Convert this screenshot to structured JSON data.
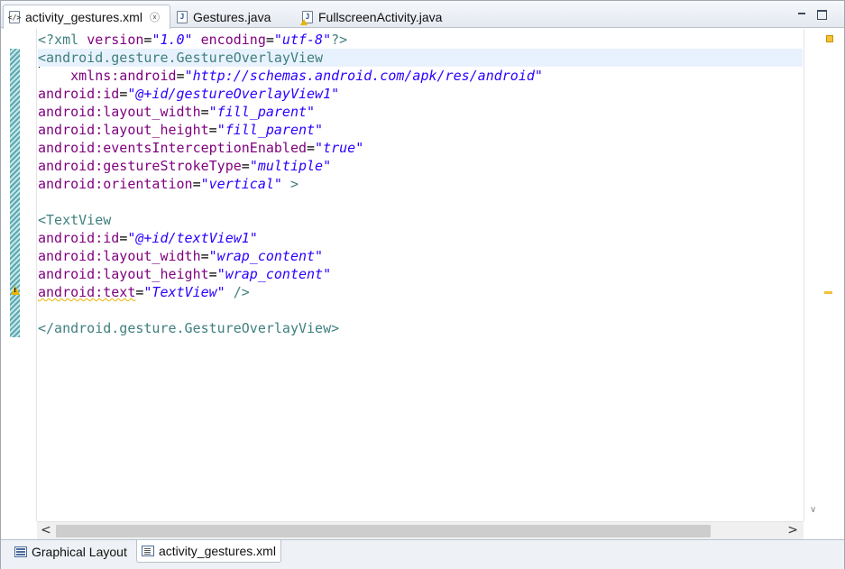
{
  "editor_tabs": [
    {
      "label": "activity_gestures.xml",
      "icon": "xml-file-icon",
      "active": true,
      "close_glyph": "ⓧ"
    },
    {
      "label": "Gestures.java",
      "icon": "java-file-icon",
      "active": false
    },
    {
      "label": "FullscreenActivity.java",
      "icon": "java-file-warning-icon",
      "active": false
    }
  ],
  "code_lines": [
    {
      "parts": [
        [
          "tag",
          "<?xml "
        ],
        [
          "attr",
          "version"
        ],
        [
          "eq",
          "="
        ],
        [
          "val",
          "\"1.0\""
        ],
        [
          "tag",
          " "
        ],
        [
          "attr",
          "encoding"
        ],
        [
          "eq",
          "="
        ],
        [
          "val",
          "\"utf-8\""
        ],
        [
          "tag",
          "?>"
        ]
      ]
    },
    {
      "parts": [
        [
          "tag",
          "<android.gesture.GestureOverlayView"
        ]
      ],
      "current": true
    },
    {
      "parts": [
        [
          "tag",
          "    "
        ],
        [
          "attr",
          "xmlns:android"
        ],
        [
          "eq",
          "="
        ],
        [
          "val",
          "\"http://schemas.android.com/apk/res/android\""
        ]
      ]
    },
    {
      "parts": [
        [
          "attr",
          "android:id"
        ],
        [
          "eq",
          "="
        ],
        [
          "val",
          "\"@+id/gestureOverlayView1\""
        ]
      ]
    },
    {
      "parts": [
        [
          "attr",
          "android:layout_width"
        ],
        [
          "eq",
          "="
        ],
        [
          "val",
          "\"fill_parent\""
        ]
      ]
    },
    {
      "parts": [
        [
          "attr",
          "android:layout_height"
        ],
        [
          "eq",
          "="
        ],
        [
          "val",
          "\"fill_parent\""
        ]
      ]
    },
    {
      "parts": [
        [
          "attr",
          "android:eventsInterceptionEnabled"
        ],
        [
          "eq",
          "="
        ],
        [
          "val",
          "\"true\""
        ]
      ]
    },
    {
      "parts": [
        [
          "attr",
          "android:gestureStrokeType"
        ],
        [
          "eq",
          "="
        ],
        [
          "val",
          "\"multiple\""
        ]
      ]
    },
    {
      "parts": [
        [
          "attr",
          "android:orientation"
        ],
        [
          "eq",
          "="
        ],
        [
          "val",
          "\"vertical\""
        ],
        [
          "tag",
          " >"
        ]
      ]
    },
    {
      "parts": []
    },
    {
      "parts": [
        [
          "tag",
          "<TextView"
        ]
      ]
    },
    {
      "parts": [
        [
          "attr",
          "android:id"
        ],
        [
          "eq",
          "="
        ],
        [
          "val",
          "\"@+id/textView1\""
        ]
      ]
    },
    {
      "parts": [
        [
          "attr",
          "android:layout_width"
        ],
        [
          "eq",
          "="
        ],
        [
          "val",
          "\"wrap_content\""
        ]
      ]
    },
    {
      "parts": [
        [
          "attr",
          "android:layout_height"
        ],
        [
          "eq",
          "="
        ],
        [
          "val",
          "\"wrap_content\""
        ]
      ]
    },
    {
      "parts": [
        [
          "attr",
          "android:text"
        ],
        [
          "eq",
          "="
        ],
        [
          "val",
          "\"TextView\""
        ],
        [
          "tag",
          " />"
        ]
      ],
      "warning": true
    },
    {
      "parts": []
    },
    {
      "parts": [
        [
          "tag",
          "</android.gesture.GestureOverlayView>"
        ]
      ]
    }
  ],
  "bottom_tabs": [
    {
      "label": "Graphical Layout",
      "icon": "layout-icon",
      "active": false
    },
    {
      "label": "activity_gestures.xml",
      "icon": "xml-source-icon",
      "active": true
    }
  ],
  "colors": {
    "xml_tag": "#3f7f7f",
    "xml_attribute": "#7f007f",
    "xml_value": "#2a00ff",
    "current_line": "#e8f2fe",
    "warning": "#e8b400"
  }
}
